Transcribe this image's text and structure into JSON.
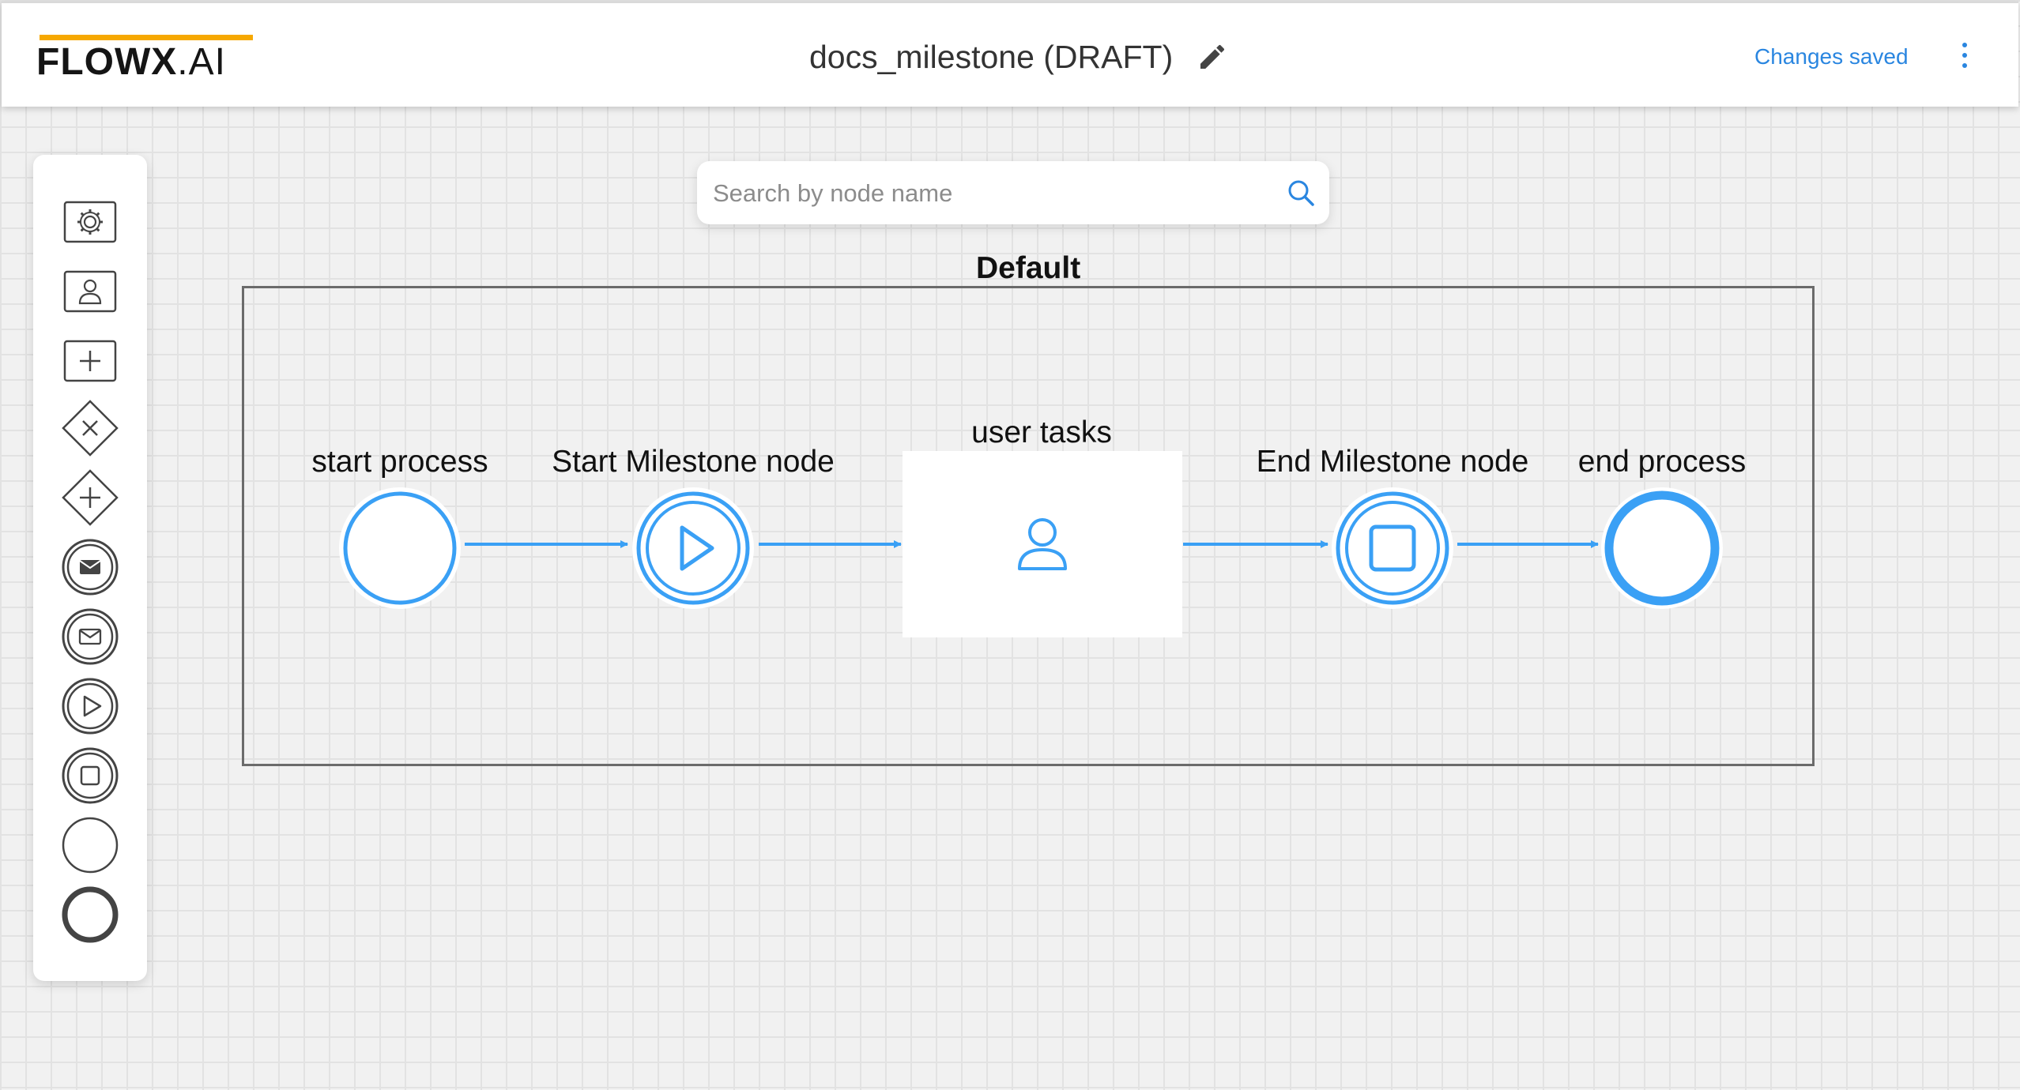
{
  "header": {
    "logo_bold": "FLOWX",
    "logo_light": ".AI",
    "process_title": "docs_milestone (DRAFT)",
    "edit_icon": "pencil-icon",
    "status": "Changes saved",
    "menu_icon": "more-vertical-icon",
    "accent_color": "#2a86e0",
    "logo_accent_color": "#f6a800"
  },
  "palette": {
    "items": [
      {
        "icon": "service-task-gear-icon"
      },
      {
        "icon": "user-task-icon"
      },
      {
        "icon": "subprocess-plus-icon"
      },
      {
        "icon": "exclusive-gateway-icon"
      },
      {
        "icon": "parallel-gateway-icon"
      },
      {
        "icon": "message-throw-event-icon"
      },
      {
        "icon": "message-catch-event-icon"
      },
      {
        "icon": "start-milestone-icon"
      },
      {
        "icon": "end-milestone-icon"
      },
      {
        "icon": "start-event-icon"
      },
      {
        "icon": "end-event-icon"
      }
    ]
  },
  "search": {
    "placeholder": "Search by node name",
    "icon": "search-icon"
  },
  "canvas": {
    "swimlane_title": "Default",
    "nodes": [
      {
        "label": "start process",
        "type": "start-event"
      },
      {
        "label": "Start Milestone node",
        "type": "start-milestone"
      },
      {
        "label": "user tasks",
        "type": "user-task"
      },
      {
        "label": "End Milestone node",
        "type": "end-milestone"
      },
      {
        "label": "end process",
        "type": "end-event"
      }
    ],
    "flow_color": "#3aa0f5"
  }
}
